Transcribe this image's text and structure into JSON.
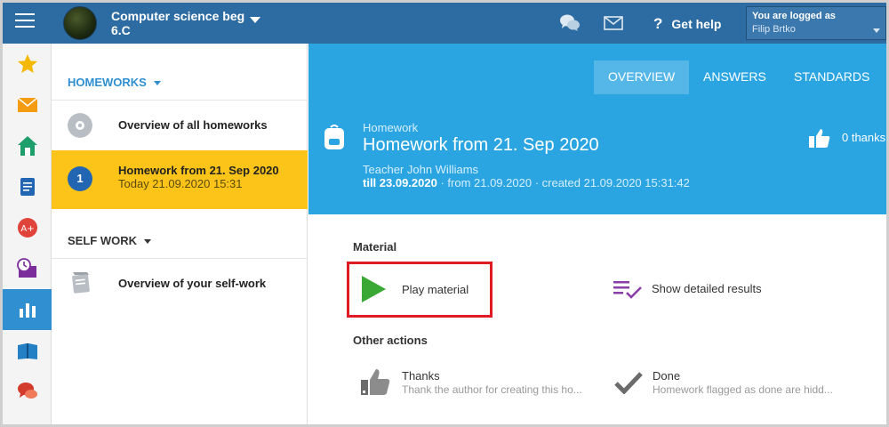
{
  "header": {
    "course_name": "Computer science beg",
    "course_class": "6.C",
    "help_label": "Get help",
    "login_caption": "You are logged as",
    "login_user": "Filip Brtko"
  },
  "sidebar_icons": [
    "star-icon",
    "mail-icon",
    "home-icon",
    "notebook-icon",
    "grade-icon",
    "schedule-icon",
    "chart-icon",
    "book-icon",
    "discussion-icon"
  ],
  "homeworks": {
    "heading": "HOMEWORKS",
    "overview_label": "Overview of all homeworks",
    "selected": {
      "badge": "1",
      "title": "Homework from 21. Sep 2020",
      "date": "Today 21.09.2020 15:31"
    }
  },
  "selfwork": {
    "heading": "SELF WORK",
    "overview_label": "Overview of your self-work"
  },
  "tabs": [
    {
      "label": "OVERVIEW",
      "active": true
    },
    {
      "label": "ANSWERS",
      "active": false
    },
    {
      "label": "STANDARDS",
      "active": false
    }
  ],
  "homework": {
    "kind": "Homework",
    "title": "Homework from 21. Sep 2020",
    "teacher": "Teacher John Williams",
    "deadline": "till 23.09.2020",
    "from": " · from 21.09.2020",
    "created": " · created 21.09.2020 15:31:42",
    "thanks_count": "0 thanks"
  },
  "material": {
    "heading": "Material",
    "play_label": "Play material",
    "results_label": "Show detailed results"
  },
  "other_actions": {
    "heading": "Other actions",
    "thanks_label": "Thanks",
    "thanks_desc": "Thank the author for creating this ho...",
    "done_label": "Done",
    "done_desc": "Homework flagged as done are hidd..."
  },
  "colors": {
    "topbar": "#2d6ca2",
    "accent_blue": "#2ba5e2",
    "selected_yellow": "#fcc419",
    "play_green": "#3aa835",
    "results_purple": "#8a3fa8",
    "highlight_red": "#e01b24"
  }
}
